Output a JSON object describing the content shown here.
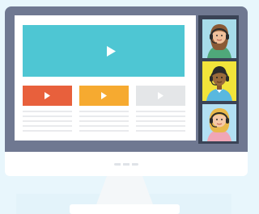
{
  "colors": {
    "background": "#e8f6fc",
    "monitor_bezel": "#6f7891",
    "monitor_chin": "#ffffff",
    "monitor_stand": "#f4f7f9",
    "screen": "#ffffff",
    "hero_video": "#4ec6d3",
    "card_red": "#e8603c",
    "card_orange": "#f6aa30",
    "card_grey": "#e4e6e8",
    "text_line": "#e2e4e7",
    "participant_panel": "#3a4356",
    "participant_bg_1": "#a7dcea",
    "participant_bg_2": "#f2e43a",
    "participant_bg_3": "#b2e0f3"
  },
  "icons": {
    "play": "play-icon",
    "headset": "headset-icon"
  },
  "participants": [
    {
      "id": "participant-1",
      "hair": "#8a5a36",
      "skin": "#f0c09b",
      "shirt": "#4fa87a"
    },
    {
      "id": "participant-2",
      "hair": "#2a2a2a",
      "skin": "#9a6a3c",
      "shirt": "#59b8df"
    },
    {
      "id": "participant-3",
      "hair": "#e8b94a",
      "skin": "#f4c8a6",
      "shirt": "#f0a6b6"
    }
  ]
}
